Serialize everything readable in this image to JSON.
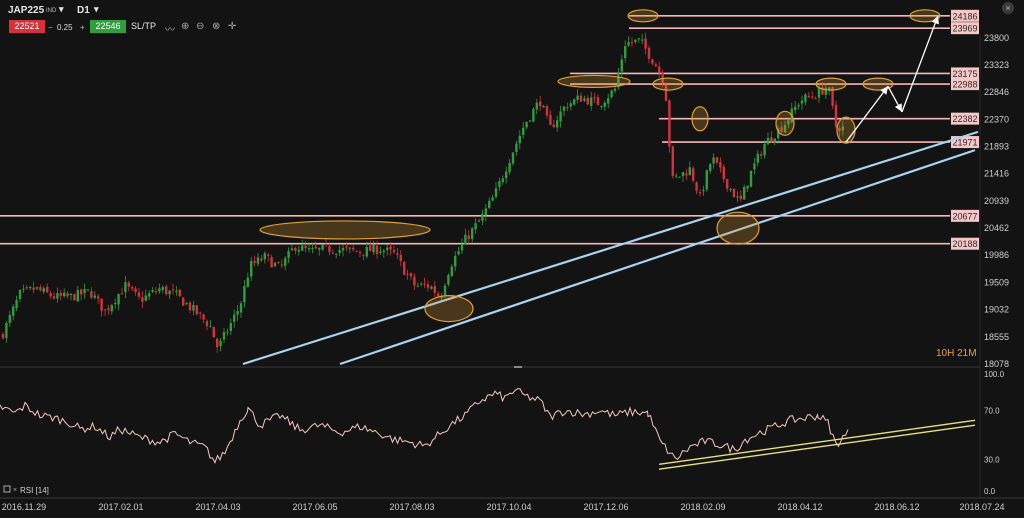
{
  "toolbar": {
    "symbol": "JAP225",
    "symbol_tag": "IND",
    "timeframe": "D1",
    "bid": "22521",
    "spread": "0.25",
    "ask": "22546",
    "sltp": "SL/TP",
    "icons": [
      "line-chart-icon",
      "zoom-in-icon",
      "zoom-out-icon",
      "crosshair-zoom-icon",
      "crosshair-icon"
    ],
    "close": "×"
  },
  "timer": "10H 21M",
  "colors": {
    "background": "#131313",
    "bull": "#2e9e3e",
    "bear": "#d6323c",
    "level": "#f4b6b6",
    "channel": "#a9d3ee",
    "rsi": "#f6c8c0",
    "rsi_trend": "#e8e07a",
    "ellipse": "#e0a030"
  },
  "chart_data": [
    {
      "type": "candlestick",
      "title": "",
      "x_ticks": [
        "2016.11.29",
        "2017.02.01",
        "2017.04.03",
        "2017.06.05",
        "2017.08.03",
        "2017.10.04",
        "2017.12.06",
        "2018.02.09",
        "2018.04.12",
        "2018.06.12",
        "2018.07.24"
      ],
      "y_ticks": [
        18078,
        18555,
        19032,
        19509,
        19986,
        20462,
        20939,
        21416,
        21893,
        22370,
        22846,
        23323,
        23800
      ],
      "ylim": [
        18078,
        24200
      ],
      "price_path": [
        [
          0,
          18500
        ],
        [
          20,
          19300
        ],
        [
          35,
          19400
        ],
        [
          55,
          19250
        ],
        [
          70,
          19250
        ],
        [
          90,
          19350
        ],
        [
          105,
          19000
        ],
        [
          125,
          19450
        ],
        [
          140,
          19200
        ],
        [
          160,
          19400
        ],
        [
          175,
          19300
        ],
        [
          195,
          19000
        ],
        [
          210,
          18750
        ],
        [
          218,
          18350
        ],
        [
          240,
          19100
        ],
        [
          250,
          19800
        ],
        [
          265,
          19950
        ],
        [
          280,
          19750
        ],
        [
          295,
          20150
        ],
        [
          310,
          20050
        ],
        [
          330,
          20100
        ],
        [
          360,
          20050
        ],
        [
          380,
          20100
        ],
        [
          395,
          20000
        ],
        [
          405,
          19700
        ],
        [
          415,
          19450
        ],
        [
          430,
          19450
        ],
        [
          440,
          19250
        ],
        [
          450,
          19800
        ],
        [
          465,
          20250
        ],
        [
          480,
          20600
        ],
        [
          495,
          21050
        ],
        [
          510,
          21700
        ],
        [
          525,
          22300
        ],
        [
          540,
          22700
        ],
        [
          550,
          22200
        ],
        [
          565,
          22600
        ],
        [
          580,
          22750
        ],
        [
          600,
          22650
        ],
        [
          615,
          22900
        ],
        [
          625,
          23700
        ],
        [
          640,
          23750
        ],
        [
          655,
          23350
        ],
        [
          665,
          23000
        ],
        [
          672,
          21300
        ],
        [
          690,
          21500
        ],
        [
          700,
          21000
        ],
        [
          712,
          21700
        ],
        [
          725,
          21300
        ],
        [
          740,
          20900
        ],
        [
          750,
          21400
        ],
        [
          765,
          21950
        ],
        [
          785,
          22300
        ],
        [
          800,
          22700
        ],
        [
          815,
          22800
        ],
        [
          828,
          22950
        ],
        [
          836,
          22250
        ],
        [
          846,
          22200
        ]
      ],
      "levels": [
        24186,
        23969,
        23175,
        22988,
        22382,
        21971,
        20677,
        20188
      ],
      "channel_lines": [
        [
          [
            243,
            18078
          ],
          [
            978,
            22150
          ]
        ],
        [
          [
            340,
            18078
          ],
          [
            975,
            21830
          ]
        ]
      ],
      "projection_arrows": [
        [
          [
            846,
            21971
          ],
          [
            888,
            22950
          ]
        ],
        [
          [
            888,
            22950
          ],
          [
            902,
            22500
          ]
        ],
        [
          [
            902,
            22500
          ],
          [
            938,
            24186
          ]
        ]
      ],
      "highlight_ellipses": [
        [
          643,
          24186
        ],
        [
          594,
          23035
        ],
        [
          668,
          22988
        ],
        [
          925,
          24186
        ],
        [
          831,
          22988
        ],
        [
          878,
          22988
        ],
        [
          700,
          22380
        ],
        [
          785,
          22300
        ],
        [
          846,
          22180
        ],
        [
          345,
          20430
        ],
        [
          738,
          20460
        ],
        [
          449,
          19050
        ]
      ]
    },
    {
      "type": "line",
      "title": "RSI [14]",
      "y_ticks": [
        0.0,
        30.0,
        70.0,
        100.0
      ],
      "ylim": [
        0,
        100
      ],
      "rsi_path": [
        [
          0,
          73
        ],
        [
          15,
          68
        ],
        [
          25,
          74
        ],
        [
          40,
          66
        ],
        [
          55,
          64
        ],
        [
          70,
          60
        ],
        [
          80,
          55
        ],
        [
          95,
          57
        ],
        [
          110,
          48
        ],
        [
          120,
          55
        ],
        [
          140,
          48
        ],
        [
          160,
          44
        ],
        [
          175,
          51
        ],
        [
          190,
          44
        ],
        [
          205,
          40
        ],
        [
          215,
          28
        ],
        [
          225,
          36
        ],
        [
          240,
          62
        ],
        [
          248,
          72
        ],
        [
          260,
          58
        ],
        [
          280,
          66
        ],
        [
          300,
          54
        ],
        [
          320,
          58
        ],
        [
          340,
          52
        ],
        [
          360,
          57
        ],
        [
          380,
          51
        ],
        [
          395,
          46
        ],
        [
          410,
          44
        ],
        [
          425,
          41
        ],
        [
          440,
          51
        ],
        [
          450,
          58
        ],
        [
          465,
          66
        ],
        [
          480,
          78
        ],
        [
          495,
          84
        ],
        [
          505,
          80
        ],
        [
          515,
          87
        ],
        [
          525,
          82
        ],
        [
          540,
          78
        ],
        [
          550,
          65
        ],
        [
          565,
          70
        ],
        [
          585,
          67
        ],
        [
          600,
          70
        ],
        [
          615,
          66
        ],
        [
          630,
          69
        ],
        [
          648,
          68
        ],
        [
          660,
          45
        ],
        [
          675,
          30
        ],
        [
          690,
          40
        ],
        [
          705,
          45
        ],
        [
          720,
          42
        ],
        [
          735,
          38
        ],
        [
          745,
          46
        ],
        [
          760,
          52
        ],
        [
          775,
          57
        ],
        [
          790,
          62
        ],
        [
          805,
          64
        ],
        [
          818,
          66
        ],
        [
          828,
          60
        ],
        [
          836,
          42
        ],
        [
          843,
          48
        ],
        [
          850,
          53
        ]
      ],
      "trend_lines": [
        [
          [
            659,
            26
          ],
          [
            975,
            62
          ]
        ],
        [
          [
            659,
            22
          ],
          [
            975,
            58
          ]
        ]
      ]
    }
  ]
}
